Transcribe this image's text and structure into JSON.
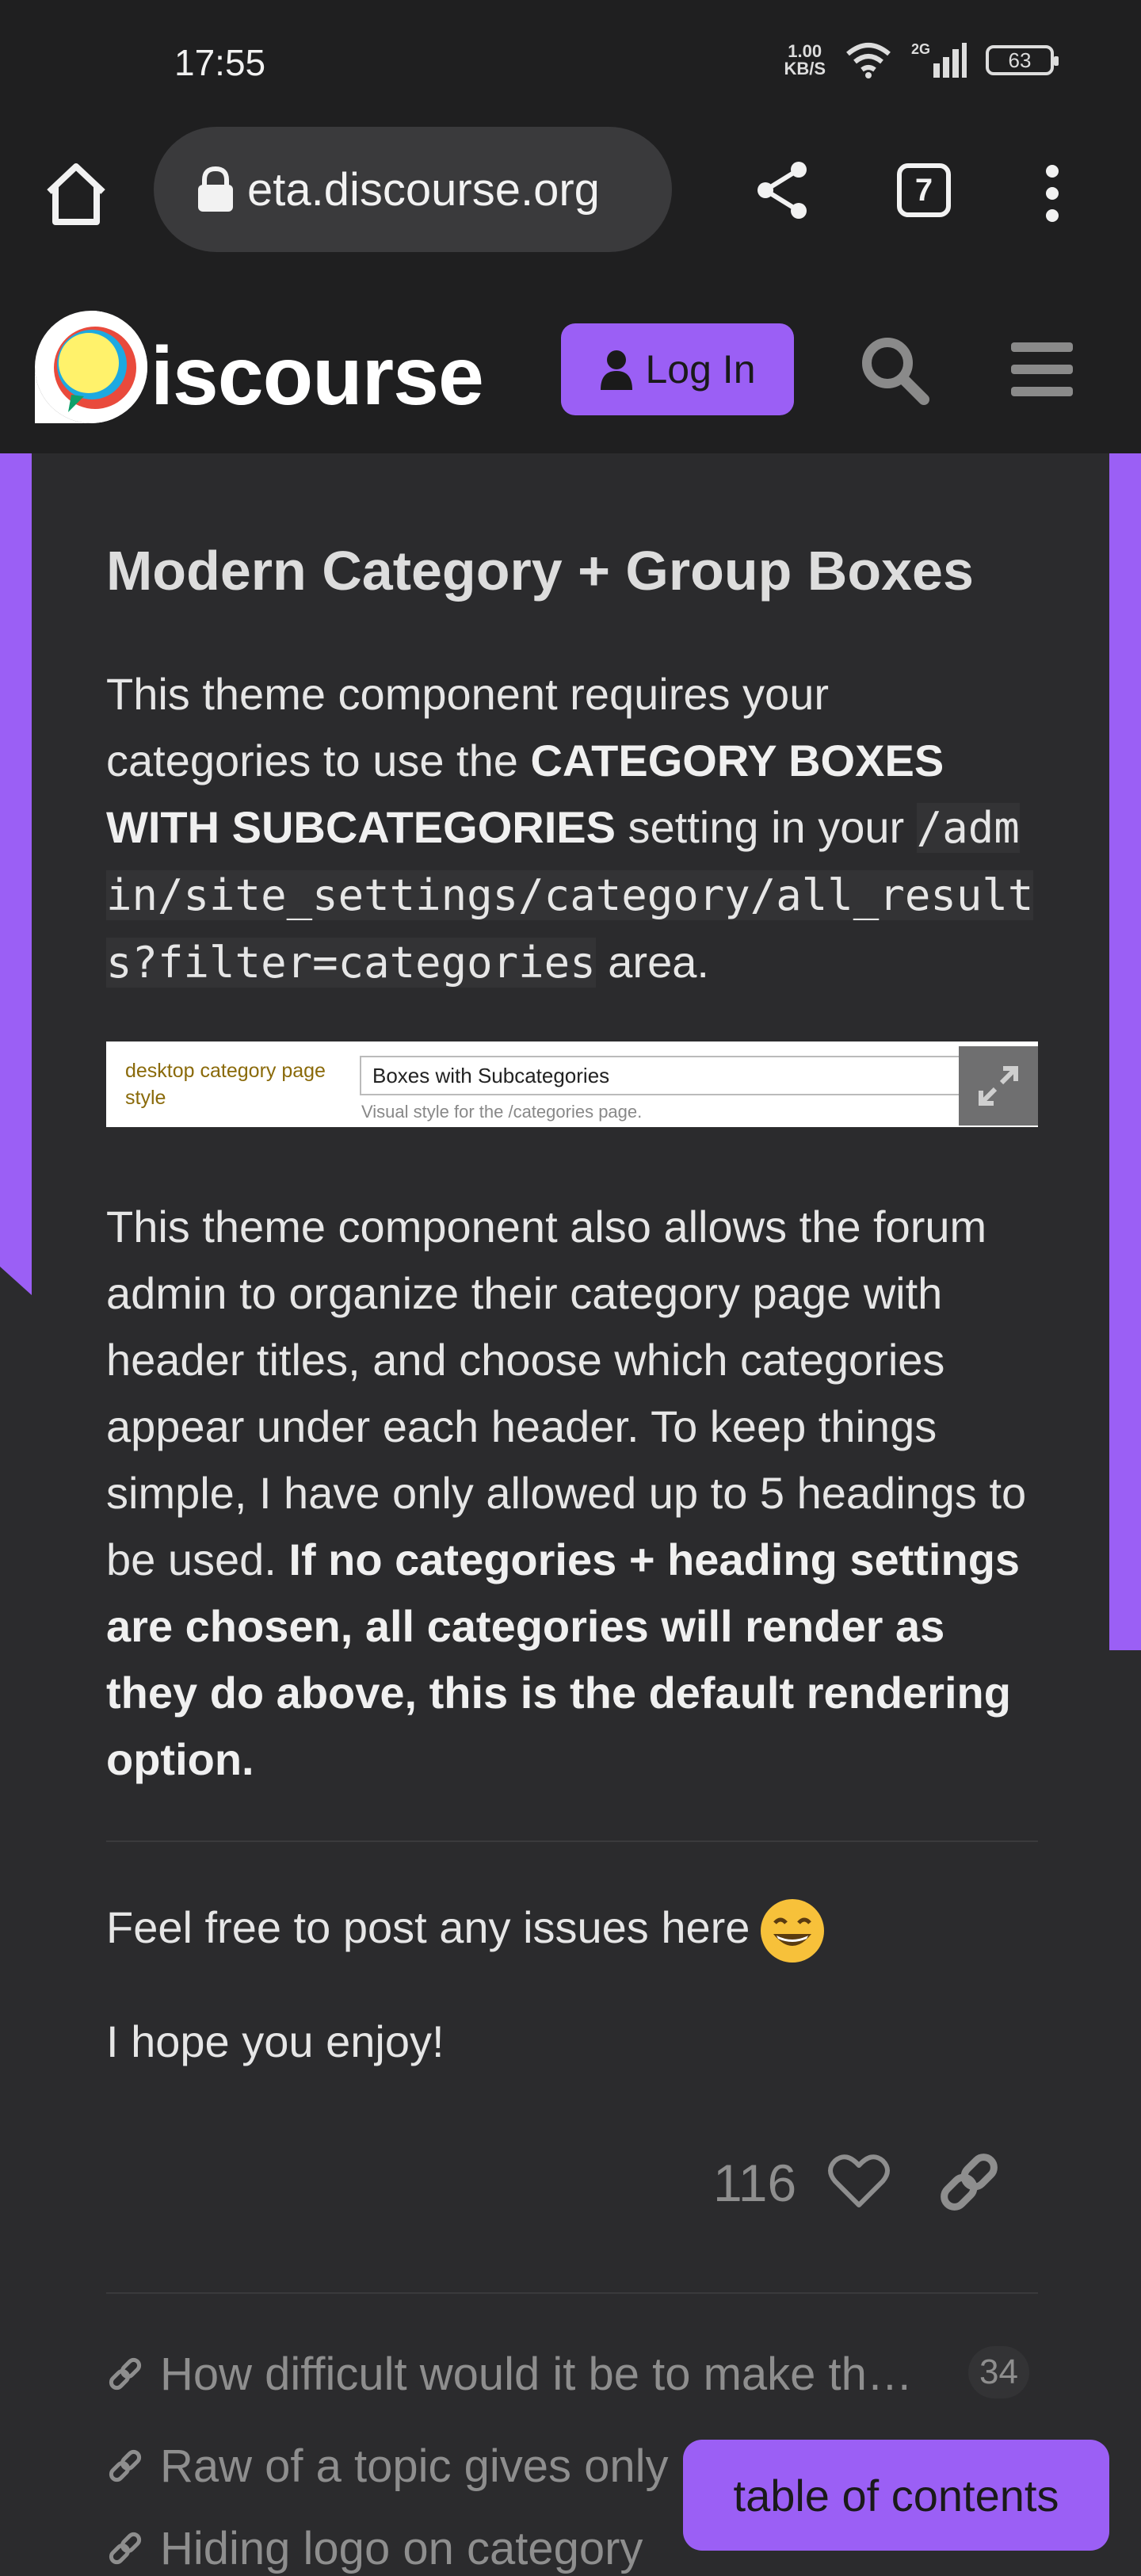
{
  "status_bar": {
    "time": "17:55",
    "net_speed_value": "1.00",
    "net_speed_unit": "KB/S",
    "network_type": "2G",
    "battery": "63"
  },
  "browser": {
    "url": "eta.discourse.org",
    "tab_count": "7"
  },
  "site_header": {
    "logo_text": "iscourse",
    "login_label": "Log In",
    "accent_color": "#9b5ff5"
  },
  "post": {
    "title": "Modern Category + Group Boxes",
    "p1_a": "This theme component requires your categories to use the ",
    "p1_bold": "CATEGORY BOXES WITH SUBCATEGORIES",
    "p1_b": " setting in your ",
    "p1_code": "/admin/site_settings/category/all_results?filter=categories",
    "p1_c": " area.",
    "setting_image": {
      "label": "desktop category page style",
      "select_value": "Boxes with Subcategories",
      "hint": "Visual style for the /categories page."
    },
    "p2_a": "This theme component also allows the forum admin to organize their category page with header titles, and choose which categories appear under each header. To keep things simple, I have only allowed up to 5 headings to be used. ",
    "p2_bold": "If no categories + heading settings are chosen, all categories will render as they do above, this is the default rendering option.",
    "p3": "Feel free to post any issues here",
    "p4": "I hope you enjoy!",
    "like_count": "116"
  },
  "topic_links": [
    {
      "text": "How difficult would it be to make th…",
      "count": "34"
    },
    {
      "text": "Raw of a topic gives only"
    },
    {
      "text": "Hiding logo on category"
    }
  ],
  "toc_label": "table of contents"
}
